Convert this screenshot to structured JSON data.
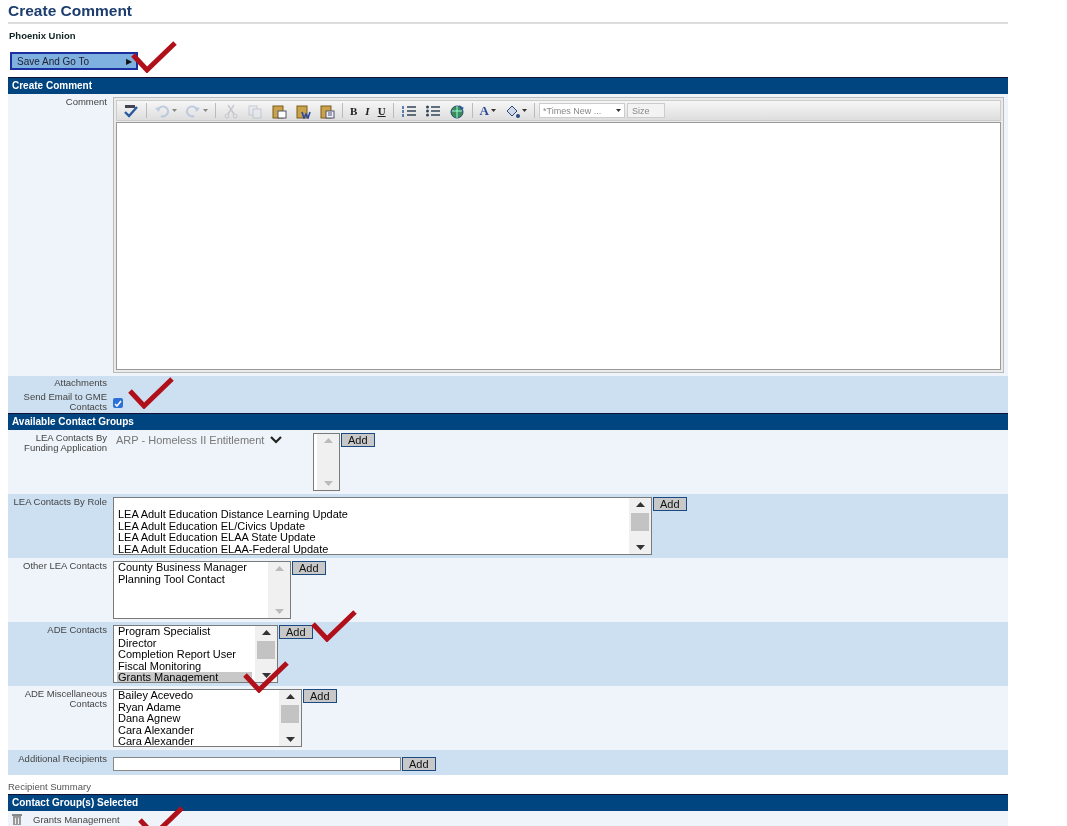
{
  "page_title": "Create Comment",
  "organization": "Phoenix Union",
  "save_menu": {
    "label": "Save And Go To",
    "arrow": "▶"
  },
  "comment_section": {
    "title": "Create Comment",
    "comment_label": "Comment",
    "toolbar": [
      {
        "kind": "spellcheck",
        "disabled": false,
        "has_menu": false
      },
      {
        "kind": "undo",
        "disabled": true,
        "has_menu": true
      },
      {
        "kind": "redo",
        "disabled": true,
        "has_menu": true
      },
      {
        "kind": "cut",
        "disabled": true,
        "has_menu": false
      },
      {
        "kind": "copy",
        "disabled": true,
        "has_menu": false
      },
      {
        "kind": "paste",
        "disabled": false,
        "has_menu": false
      },
      {
        "kind": "paste-word",
        "disabled": false,
        "has_menu": false
      },
      {
        "kind": "paste-text",
        "disabled": false,
        "has_menu": false
      },
      {
        "kind": "bold",
        "label": "B",
        "disabled": false,
        "has_menu": false
      },
      {
        "kind": "italic",
        "label": "I",
        "disabled": false,
        "has_menu": false
      },
      {
        "kind": "underline",
        "label": "U",
        "disabled": false,
        "has_menu": false
      },
      {
        "kind": "ordered-list",
        "disabled": false,
        "has_menu": false
      },
      {
        "kind": "bullet-list",
        "disabled": false,
        "has_menu": false
      },
      {
        "kind": "image",
        "disabled": false,
        "has_menu": false
      },
      {
        "kind": "font-color",
        "label": "A",
        "disabled": false,
        "has_menu": true
      },
      {
        "kind": "highlight",
        "disabled": false,
        "has_menu": true
      }
    ],
    "font_select": {
      "value": "*Times New ..."
    },
    "size_select": {
      "placeholder": "Size"
    },
    "attachments_label": "Attachments",
    "send_email": {
      "label": "Send Email to GME Contacts",
      "checked": true
    }
  },
  "contact_groups": {
    "title": "Available Contact Groups",
    "rows": [
      {
        "kind": "dropdown",
        "label": "LEA Contacts By Funding Application",
        "dropdown": {
          "value": "ARP - Homeless II Entitlement",
          "disabled": true
        },
        "button": "Add"
      },
      {
        "kind": "list",
        "label": "LEA Contacts By Role",
        "items": [
          {
            "text": "LEA Adult Education Distance Learning Update",
            "selected": false
          },
          {
            "text": "LEA Adult Education EL/Civics Update",
            "selected": false
          },
          {
            "text": "LEA Adult Education ELAA State Update",
            "selected": false
          },
          {
            "text": "LEA Adult Education ELAA-Federal Update",
            "selected": false
          }
        ],
        "button": "Add"
      },
      {
        "kind": "list",
        "label": "Other LEA Contacts",
        "items": [
          {
            "text": "County Business Manager",
            "selected": false
          },
          {
            "text": "Planning Tool Contact",
            "selected": false
          }
        ],
        "button": "Add"
      },
      {
        "kind": "list",
        "label": "ADE Contacts",
        "items": [
          {
            "text": "Program Specialist",
            "selected": false
          },
          {
            "text": "Director",
            "selected": false
          },
          {
            "text": "Completion Report User",
            "selected": false
          },
          {
            "text": "Fiscal Monitoring",
            "selected": false
          },
          {
            "text": "Grants Management",
            "selected": true
          }
        ],
        "button": "Add"
      },
      {
        "kind": "list",
        "label": "ADE Miscellaneous Contacts",
        "items": [
          {
            "text": "Bailey Acevedo",
            "selected": false
          },
          {
            "text": "Ryan Adame",
            "selected": false
          },
          {
            "text": "Dana Agnew",
            "selected": false
          },
          {
            "text": "Cara Alexander",
            "selected": false
          },
          {
            "text": "Cara Alexander",
            "selected": false
          }
        ],
        "button": "Add"
      },
      {
        "kind": "text-input",
        "label": "Additional Recipients",
        "button": "Add"
      }
    ]
  },
  "recipient_summary": {
    "label": "Recipient Summary",
    "title": "Contact Group(s) Selected",
    "entries": [
      {
        "name": "Grants Management"
      }
    ]
  }
}
